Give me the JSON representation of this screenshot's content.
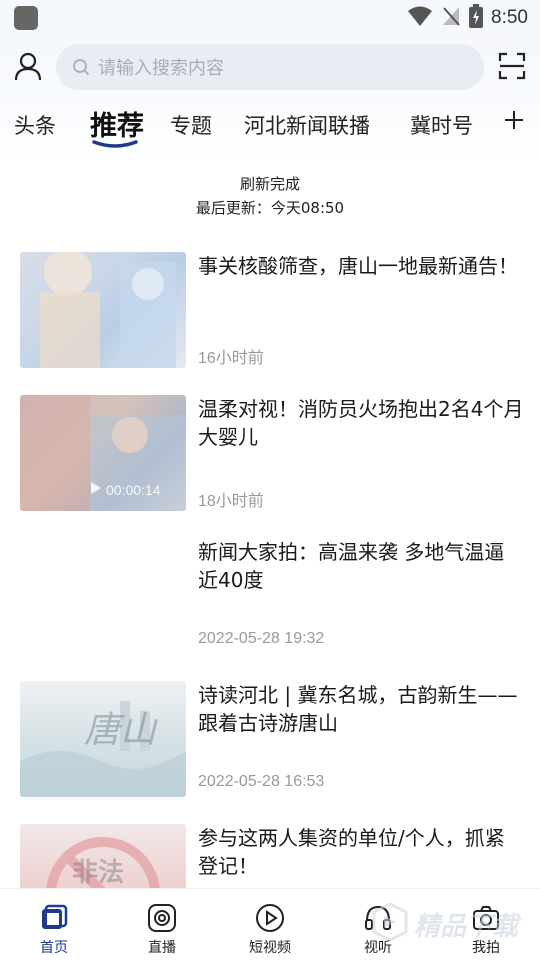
{
  "status_bar": {
    "time": "8:50"
  },
  "header": {
    "search_placeholder": "请输入搜索内容"
  },
  "tabs": [
    {
      "label": "头条"
    },
    {
      "label": "推荐",
      "active": true
    },
    {
      "label": "专题"
    },
    {
      "label": "河北新闻联播"
    },
    {
      "label": "冀时号"
    }
  ],
  "refresh": {
    "status": "刷新完成",
    "last_update": "最后更新：今天08:50"
  },
  "news": [
    {
      "title": "事关核酸筛查，唐山一地最新通告！",
      "time": "16小时前",
      "has_thumb": true
    },
    {
      "title": "温柔对视！消防员火场抱出2名4个月大婴儿",
      "time": "18小时前",
      "has_thumb": true,
      "video_duration": "00:00:14"
    },
    {
      "title": "新闻大家拍：高温来袭 多地气温逼近40度",
      "time": "2022-05-28 19:32",
      "has_thumb": false
    },
    {
      "title": "诗读河北 | 冀东名城，古韵新生——跟着古诗游唐山",
      "time": "2022-05-28 16:53",
      "has_thumb": true,
      "thumb_text": "唐山"
    },
    {
      "title": "参与这两人集资的单位/个人，抓紧登记！",
      "time": "",
      "has_thumb": true,
      "thumb_text": "非法"
    }
  ],
  "bottom_nav": [
    {
      "label": "首页",
      "icon": "home-icon",
      "active": true
    },
    {
      "label": "直播",
      "icon": "live-icon"
    },
    {
      "label": "短视频",
      "icon": "short-video-icon"
    },
    {
      "label": "视听",
      "icon": "audio-visual-icon"
    },
    {
      "label": "我拍",
      "icon": "camera-icon"
    }
  ],
  "watermark": {
    "text": "精品下载"
  },
  "colors": {
    "accent": "#1e3a8a",
    "search_bg": "#e9edf3",
    "time_text": "#9a9a9a"
  }
}
